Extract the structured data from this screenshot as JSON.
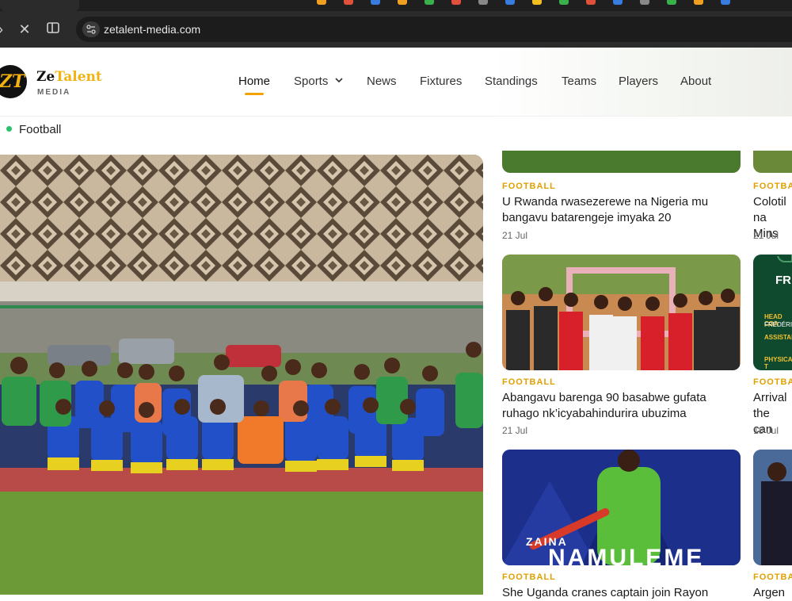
{
  "browser": {
    "url": "zetalent-media.com",
    "close_icon": "close-icon",
    "split_icon": "split-view-icon",
    "site_info_icon": "site-info-icon"
  },
  "site": {
    "logo_mark": "ZT",
    "logo_name_a": "Ze",
    "logo_name_b": "Talent",
    "logo_sub": "MEDIA",
    "brand_color": "#f2b311"
  },
  "nav": {
    "items": [
      {
        "label": "Home",
        "active": true
      },
      {
        "label": "Sports",
        "dropdown": true
      },
      {
        "label": "News"
      },
      {
        "label": "Fixtures"
      },
      {
        "label": "Standings"
      },
      {
        "label": "Teams"
      },
      {
        "label": "Players"
      },
      {
        "label": "About"
      }
    ]
  },
  "breadcrumb": {
    "label": "Football",
    "dot_color": "#27c26c"
  },
  "cards": [
    {
      "category": "FOOTBALL",
      "title_line1": "U Rwanda rwasezerewe na Nigeria mu",
      "title_line2": "bangavu batarengeje imyaka 20",
      "date": "21 Jul"
    },
    {
      "category": "FOOTBA",
      "title_line1": "Colotil",
      "title_line2": "na Mins",
      "date": "21 Jul"
    },
    {
      "category": "FOOTBALL",
      "title_line1": "Abangavu barenga 90 basabwe gufata",
      "title_line2": "ruhago nk’icyabahindurira ubuzima",
      "date": "21 Jul"
    },
    {
      "category": "FOOTBA",
      "title_line1": "Arrival",
      "title_line2": "the can",
      "date": "18 Jul"
    },
    {
      "category": "FOOTBALL",
      "title_line1": "She Uganda cranes captain join Rayon",
      "title_line2": "",
      "date": ""
    },
    {
      "category": "FOOTBA",
      "title_line1": "Argen",
      "title_line2": "",
      "date": ""
    }
  ],
  "promo": {
    "name_first": "ZAINA",
    "name_last": "NAMULEME",
    "poster_text": "FR",
    "poster_line1": "HEAD COA",
    "poster_line2": "FRÉDÉRIC",
    "poster_line3": "ASSISTANT",
    "poster_line4": "PHYSICAL T"
  }
}
